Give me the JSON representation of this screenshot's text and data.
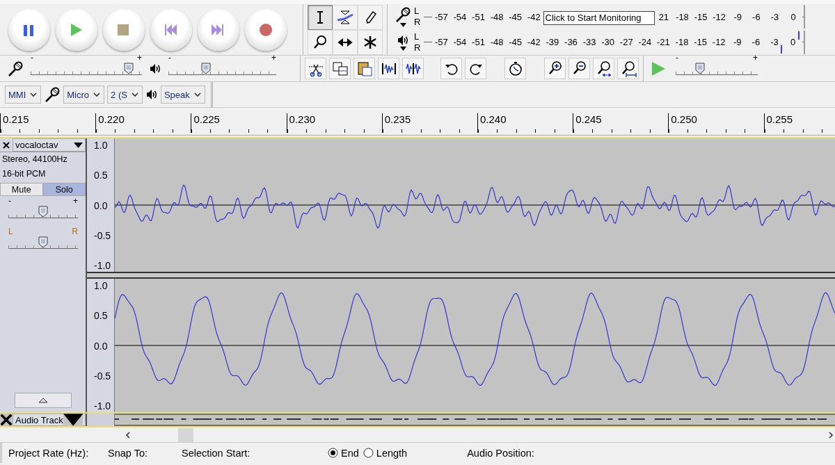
{
  "tools": [
    {
      "kind": "select",
      "selected": true
    },
    {
      "kind": "envelope",
      "selected": false
    },
    {
      "kind": "draw",
      "selected": false
    },
    {
      "kind": "zoom",
      "selected": false
    },
    {
      "kind": "timeshift",
      "selected": false
    },
    {
      "kind": "multi",
      "selected": false
    }
  ],
  "recording_meter": {
    "channels": [
      {
        "label": "L"
      },
      {
        "label": "R"
      }
    ],
    "ticks_before": [
      "-57",
      "-54",
      "-51",
      "-48",
      "-45",
      "-42"
    ],
    "tooltip": "Click to Start Monitoring",
    "ticks_after": [
      "21",
      "-18",
      "-15",
      "-12",
      "-9",
      "-6",
      "-3",
      "0"
    ]
  },
  "playback_meter": {
    "channels": [
      {
        "label": "L",
        "level": 0.985
      },
      {
        "label": "R",
        "level": 0.94
      }
    ],
    "ticks": [
      "-57",
      "-54",
      "-51",
      "-48",
      "-45",
      "-42",
      "-39",
      "-36",
      "-33",
      "-30",
      "-27",
      "-24",
      "-21",
      "-18",
      "-15",
      "-12",
      "-9",
      "-6",
      "-3",
      "0"
    ]
  },
  "mixer": {
    "input_volume": {
      "min_label": "-",
      "max_label": "+",
      "level": 0.88
    },
    "output_volume": {
      "min_label": "-",
      "max_label": "+",
      "level": 0.35
    }
  },
  "play_at_speed": {
    "min_label": "-",
    "max_label": "+",
    "level": 0.3
  },
  "devices": [
    {
      "kind": "host",
      "value": "MMI"
    },
    {
      "kind": "input",
      "value": "Micro"
    },
    {
      "kind": "channels",
      "value": "2 (S"
    },
    {
      "kind": "output",
      "value": "Speak"
    }
  ],
  "ruler": [
    "0.215",
    "0.220",
    "0.225",
    "0.230",
    "0.235",
    "0.240",
    "0.245",
    "0.250",
    "0.255"
  ],
  "tracks": [
    {
      "name": "vocaloctav",
      "info": [
        "Stereo, 44100Hz",
        "16-bit PCM"
      ],
      "mute": {
        "label": "Mute",
        "selected": false
      },
      "solo": {
        "label": "Solo",
        "selected": true
      },
      "gain": {
        "min_label": "-",
        "max_label": "+",
        "level": 0.5
      },
      "pan": {
        "min_label": "L",
        "max_label": "R",
        "level": 0.5
      },
      "channels": [
        {
          "scale": [
            "1.0",
            "0.5",
            "0.0",
            "-0.5",
            "-1.0"
          ]
        },
        {
          "scale": [
            "1.0",
            "0.5",
            "0.0",
            "-0.5",
            "-1.0"
          ]
        }
      ]
    },
    {
      "name": "Audio Track"
    }
  ],
  "selection_bar": {
    "project_rate": "Project Rate (Hz):",
    "snap_to": "Snap To:",
    "selection_start": "Selection Start:",
    "options": [
      {
        "label": "End",
        "selected": true
      },
      {
        "label": "Length",
        "selected": false
      }
    ],
    "audio_position": "Audio Position:"
  }
}
